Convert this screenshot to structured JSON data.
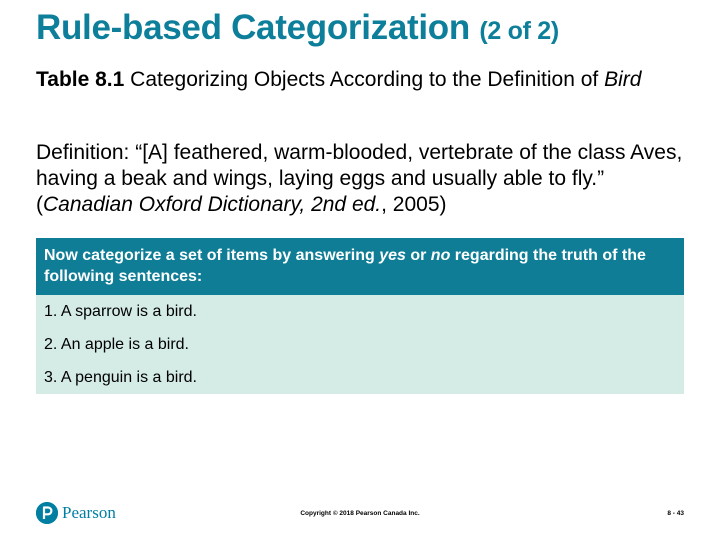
{
  "slide": {
    "title": "Rule-based Categorization",
    "title_suffix": "(2 of 2)",
    "caption_bold": "Table 8.1",
    "caption_text": " Categorizing Objects According to the Definition of ",
    "caption_italic": "Bird",
    "definition_text": "Definition: “[A] feathered, warm-blooded, vertebrate of the class Aves, having a beak and wings, laying eggs and usually able to fly.” (",
    "definition_source": "Canadian Oxford Dictionary, 2nd ed.",
    "definition_end": ", 2005)"
  },
  "table": {
    "header_part1": "Now categorize a set of items by answering ",
    "header_yes": "yes",
    "header_or": " or ",
    "header_no": "no",
    "header_part2": " regarding the truth of the following sentences:",
    "rows": [
      "1. A sparrow is a bird.",
      "2. An apple is a bird.",
      "3. A penguin is a bird."
    ]
  },
  "footer": {
    "logo_text": "Pearson",
    "copyright": "Copyright © 2018 Pearson Canada Inc.",
    "page_number": "8 - 43"
  },
  "colors": {
    "title": "#0d7f9a",
    "table_header": "#0f7d96",
    "table_body": "#d4ebe6",
    "logo": "#007fa3"
  }
}
